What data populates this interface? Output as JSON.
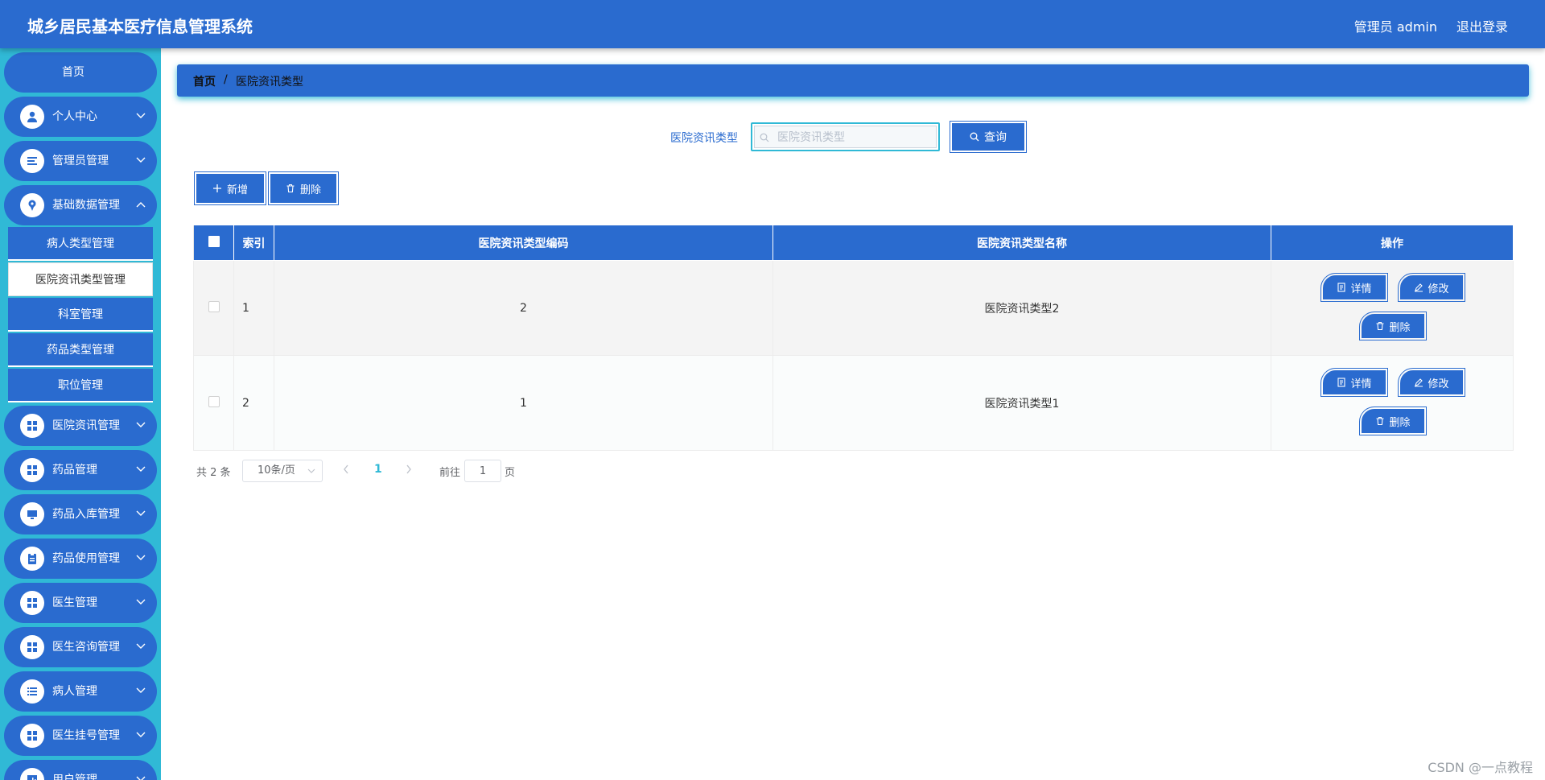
{
  "header": {
    "title": "城乡居民基本医疗信息管理系统",
    "user_label": "管理员 admin",
    "logout_label": "退出登录"
  },
  "sidebar": {
    "home_label": "首页",
    "menus_top": [
      {
        "label": "个人中心",
        "icon": "user-icon"
      },
      {
        "label": "管理员管理",
        "icon": "list-icon"
      },
      {
        "label": "基础数据管理",
        "icon": "pin-icon"
      }
    ],
    "submenu": [
      {
        "label": "病人类型管理",
        "active": false
      },
      {
        "label": "医院资讯类型管理",
        "active": true
      },
      {
        "label": "科室管理",
        "active": false
      },
      {
        "label": "药品类型管理",
        "active": false
      },
      {
        "label": "职位管理",
        "active": false
      }
    ],
    "menus_bottom": [
      {
        "label": "医院资讯管理",
        "icon": "grid-icon"
      },
      {
        "label": "药品管理",
        "icon": "grid-icon"
      },
      {
        "label": "药品入库管理",
        "icon": "monitor-icon"
      },
      {
        "label": "药品使用管理",
        "icon": "clipboard-icon"
      },
      {
        "label": "医生管理",
        "icon": "grid-icon"
      },
      {
        "label": "医生咨询管理",
        "icon": "grid-icon"
      },
      {
        "label": "病人管理",
        "icon": "list-icon"
      },
      {
        "label": "医生挂号管理",
        "icon": "grid-icon"
      },
      {
        "label": "用户管理",
        "icon": "chart-icon"
      }
    ]
  },
  "breadcrumb": {
    "home": "首页",
    "separator": "/",
    "current": "医院资讯类型"
  },
  "search": {
    "label": "医院资讯类型",
    "placeholder": "医院资讯类型",
    "value": "",
    "button_label": "查询"
  },
  "toolbar": {
    "add_label": "新增",
    "delete_label": "删除"
  },
  "table": {
    "columns": [
      "",
      "索引",
      "医院资讯类型编码",
      "医院资讯类型名称",
      "操作"
    ],
    "rows": [
      {
        "index": "1",
        "code": "2",
        "name": "医院资讯类型2"
      },
      {
        "index": "2",
        "code": "1",
        "name": "医院资讯类型1"
      }
    ],
    "actions": {
      "detail": "详情",
      "edit": "修改",
      "delete": "删除"
    }
  },
  "pagination": {
    "total_text": "共 2 条",
    "page_size": "10条/页",
    "current_page": "1",
    "goto_label": "前往",
    "goto_value": "1",
    "page_suffix": "页"
  },
  "watermark": "CSDN @一点教程",
  "colors": {
    "primary": "#2a6bcf",
    "accent": "#30b9d6"
  }
}
